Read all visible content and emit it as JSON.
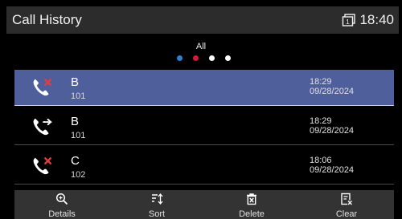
{
  "header": {
    "title": "Call History",
    "time": "18:40",
    "line_badge": "1"
  },
  "filter": {
    "label": "All",
    "dots": [
      "#2f7fd6",
      "#d21b3a",
      "#ffffff",
      "#ffffff"
    ]
  },
  "calls": [
    {
      "name": "B",
      "number": "101",
      "time": "18:29",
      "date": "09/28/2024",
      "type": "missed",
      "icon": "missed-call-icon",
      "selected": true
    },
    {
      "name": "B",
      "number": "101",
      "time": "18:29",
      "date": "09/28/2024",
      "type": "forwarded",
      "icon": "forwarded-call-icon",
      "selected": false
    },
    {
      "name": "C",
      "number": "102",
      "time": "18:06",
      "date": "09/28/2024",
      "type": "missed",
      "icon": "missed-call-icon",
      "selected": false
    }
  ],
  "softkeys": [
    {
      "label": "Details",
      "icon": "search-details-icon"
    },
    {
      "label": "Sort",
      "icon": "sort-icon"
    },
    {
      "label": "Delete",
      "icon": "delete-icon"
    },
    {
      "label": "Clear",
      "icon": "clear-icon"
    }
  ],
  "colors": {
    "selected_row": "#4f5f9c",
    "missed_mark": "#e23c3c"
  }
}
